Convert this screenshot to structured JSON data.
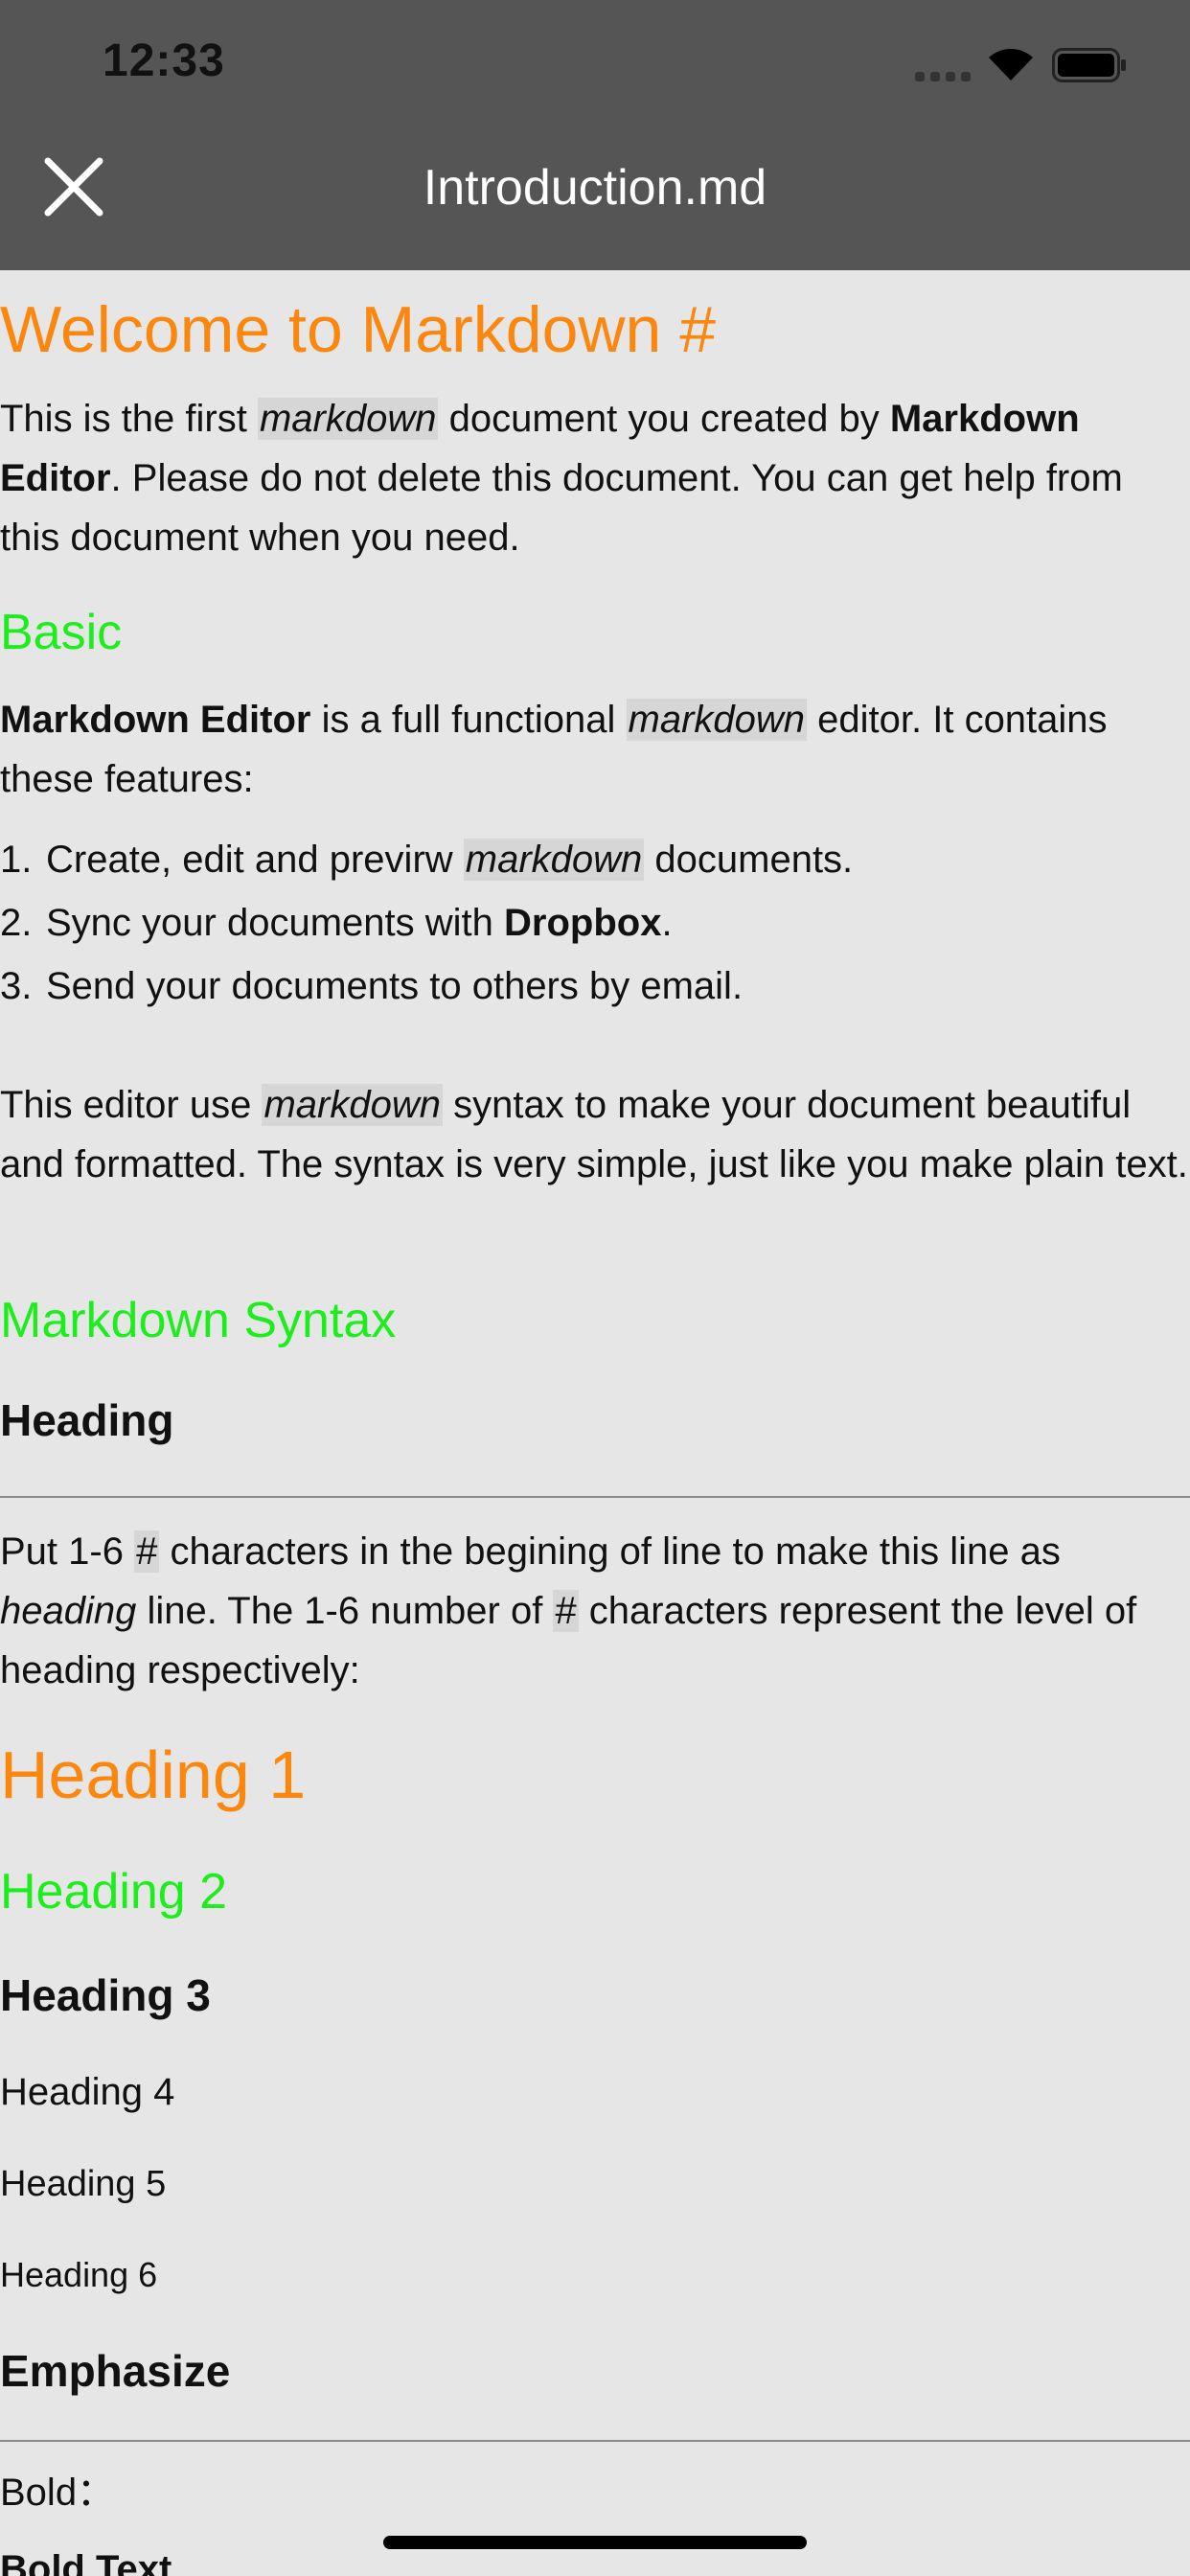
{
  "status_bar": {
    "time": "12:33"
  },
  "nav": {
    "title": "Introduction.md",
    "close_icon": "close-icon"
  },
  "doc": {
    "h1": "Welcome to Markdown #",
    "intro": {
      "a": "This is the first ",
      "code": "markdown",
      "b": " document you created by ",
      "bold": "Markdown Editor",
      "c": ". Please do not delete this document. You can get help from this document when you need."
    },
    "basic_heading": "Basic",
    "basic_p": {
      "bold": "Markdown Editor",
      "a": " is a full functional ",
      "code": "markdown",
      "b": " editor. It contains these features:"
    },
    "list": [
      {
        "num": "1.",
        "a": "Create, edit and previrw ",
        "code": "markdown",
        "b": " documents."
      },
      {
        "num": "2.",
        "a": "Sync your documents with ",
        "bold": "Dropbox",
        "b": "."
      },
      {
        "num": "3.",
        "a": "Send your documents to others by email."
      }
    ],
    "editor_p": {
      "a": "This editor use ",
      "code": "markdown",
      "b": " syntax to make your document beautiful and formatted. The syntax is very simple, just like you make plain text."
    },
    "syntax_heading": "Markdown Syntax",
    "heading_section_title": "Heading",
    "heading_p": {
      "a": "Put 1-6 ",
      "code1": "#",
      "b": " characters in the begining of line to make this line as ",
      "em": "heading",
      "c": " line. The 1-6 number of ",
      "code2": "#",
      "d": " characters represent the level of heading respectively:"
    },
    "samples": {
      "h1": "Heading 1",
      "h2": "Heading 2",
      "h3": "Heading 3",
      "h4": "Heading 4",
      "h5": "Heading 5",
      "h6": "Heading 6"
    },
    "emphasize_title": "Emphasize",
    "bold_label": "Bold：",
    "bold_text": "Bold Text"
  },
  "colors": {
    "navbar": "#555555",
    "background": "#e6e6e6",
    "h1": "#fb870f",
    "h2": "#1cee1c"
  }
}
